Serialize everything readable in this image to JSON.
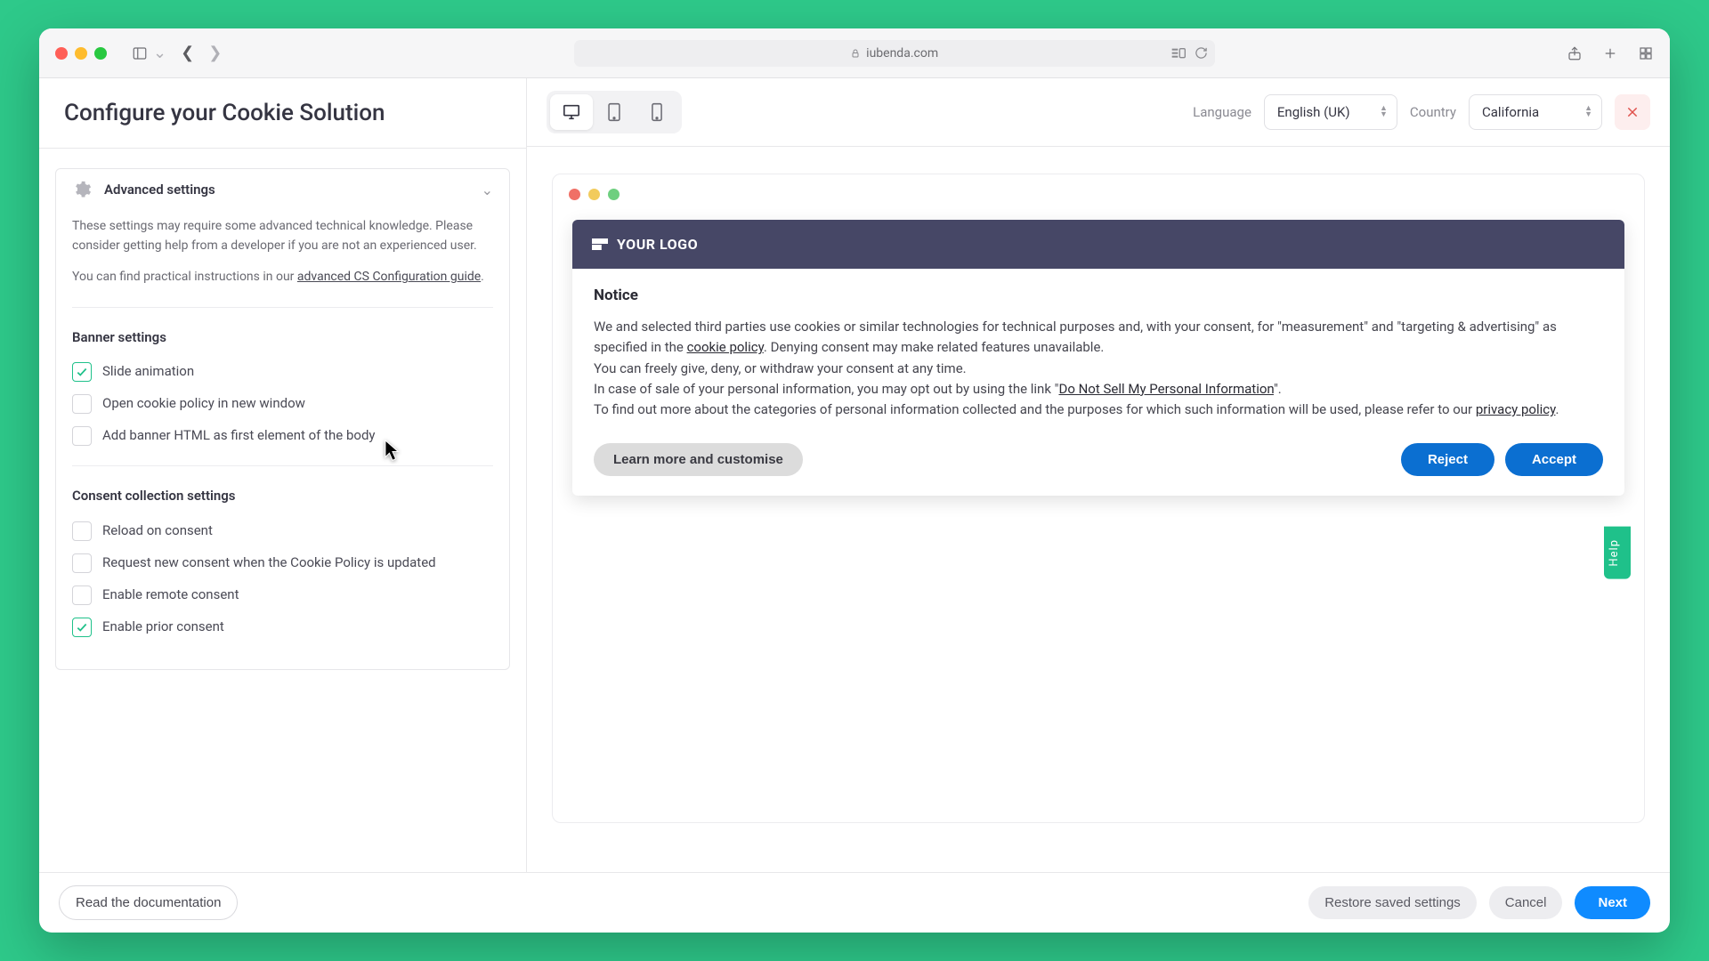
{
  "browser": {
    "url_host": "iubenda.com"
  },
  "left": {
    "page_title": "Configure your Cookie Solution",
    "advanced": {
      "title": "Advanced settings",
      "desc": "These settings may require some advanced technical knowledge. Please consider getting help from a developer if you are not an experienced user.",
      "guide_pre": "You can find practical instructions in our ",
      "guide_link": "advanced CS Configuration guide",
      "guide_post": "."
    },
    "banner_section": {
      "title": "Banner settings",
      "items": [
        {
          "label": "Slide animation",
          "checked": true
        },
        {
          "label": "Open cookie policy in new window",
          "checked": false
        },
        {
          "label": "Add banner HTML as first element of the body",
          "checked": false
        }
      ]
    },
    "consent_section": {
      "title": "Consent collection settings",
      "items": [
        {
          "label": "Reload on consent",
          "checked": false
        },
        {
          "label": "Request new consent when the Cookie Policy is updated",
          "checked": false
        },
        {
          "label": "Enable remote consent",
          "checked": false
        },
        {
          "label": "Enable prior consent",
          "checked": true
        }
      ]
    }
  },
  "right_header": {
    "language_label": "Language",
    "language_value": "English (UK)",
    "country_label": "Country",
    "country_value": "California"
  },
  "banner": {
    "logo_text": "YOUR LOGO",
    "title": "Notice",
    "p1_a": "We and selected third parties use cookies or similar technologies for technical purposes and, with your consent, for \"measurement\" and \"targeting & advertising\" as specified in the ",
    "p1_link1": "cookie policy",
    "p1_b": ". Denying consent may make related features unavailable.",
    "p2": "You can freely give, deny, or withdraw your consent at any time.",
    "p3_a": "In case of sale of your personal information, you may opt out by using the link \"",
    "p3_link": "Do Not Sell My Personal Information",
    "p3_b": "\".",
    "p4_a": "To find out more about the categories of personal information collected and the purposes for which such information will be used, please refer to our ",
    "p4_link": "privacy policy",
    "p4_b": ".",
    "learn": "Learn more and customise",
    "reject": "Reject",
    "accept": "Accept"
  },
  "footer": {
    "read_docs": "Read the documentation",
    "restore": "Restore saved settings",
    "cancel": "Cancel",
    "next": "Next"
  },
  "help_tab": "Help"
}
